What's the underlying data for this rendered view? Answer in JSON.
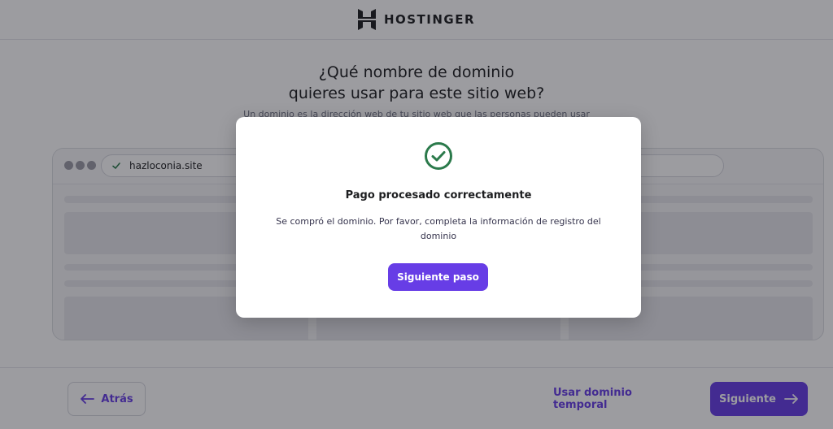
{
  "brand": {
    "name": "HOSTINGER"
  },
  "page": {
    "question_line1": "¿Qué nombre de dominio",
    "question_line2": "quieres usar para este sitio web?",
    "subtitle": "Un dominio es la dirección web de tu sitio web que las personas pueden usar"
  },
  "browser": {
    "url": "hazloconia.site"
  },
  "footer": {
    "back_label": "Atrás",
    "temp_domain_label": "Usar dominio temporal",
    "next_label": "Siguiente"
  },
  "modal": {
    "title": "Pago procesado correctamente",
    "message": "Se compró el dominio. Por favor, completa la información de registro del dominio",
    "button_label": "Siguiente paso"
  },
  "colors": {
    "accent": "#673de6",
    "success": "#2b7a4b",
    "text_dark": "#1d1e20"
  },
  "icons": {
    "logo": "hostinger-logo-icon",
    "success": "check-circle-icon",
    "url_status": "checkmark-icon",
    "back": "arrow-left-icon",
    "next": "arrow-right-icon"
  }
}
